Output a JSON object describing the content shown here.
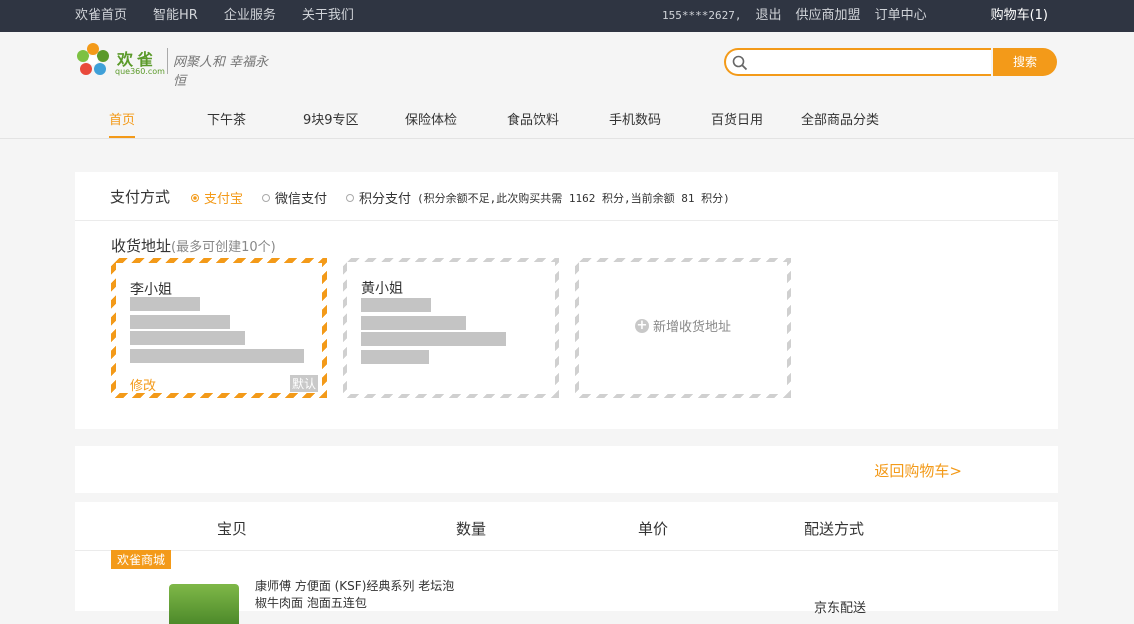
{
  "topbar": {
    "links": [
      "欢雀首页",
      "智能HR",
      "企业服务",
      "关于我们"
    ],
    "phone": "155****2627,",
    "logout": "退出",
    "supplier": "供应商加盟",
    "orders": "订单中心",
    "cart": "购物车(1)"
  },
  "logo": {
    "brand": "欢雀",
    "domain": "que360.com",
    "slogan": "网聚人和 幸福永恒"
  },
  "search": {
    "placeholder": "",
    "button": "搜索"
  },
  "nav": [
    "首页",
    "下午茶",
    "9块9专区",
    "保险体检",
    "食品饮料",
    "手机数码",
    "百货日用",
    "全部商品分类"
  ],
  "payment": {
    "label": "支付方式",
    "options": [
      "支付宝",
      "微信支付",
      "积分支付"
    ],
    "selected": "支付宝",
    "points_note": "(积分余额不足,此次购买共需 1162 积分,当前余额 81 积分)"
  },
  "address": {
    "title": "收货地址",
    "subtitle": "(最多可创建10个)",
    "cards": [
      {
        "name": "李小姐",
        "edit": "修改",
        "default_label": "默认"
      },
      {
        "name": "黄小姐"
      }
    ],
    "add_label": "新增收货地址"
  },
  "back_to_cart": "返回购物车>",
  "goods": {
    "headers": [
      "宝贝",
      "数量",
      "单价",
      "配送方式"
    ],
    "shop": "欢雀商城",
    "item_name": "康师傅 方便面 (KSF)经典系列 老坛泡椒牛肉面 泡面五连包",
    "shipping": "京东配送"
  },
  "colors": {
    "accent": "#f39a19",
    "topbar": "#2f3542"
  }
}
